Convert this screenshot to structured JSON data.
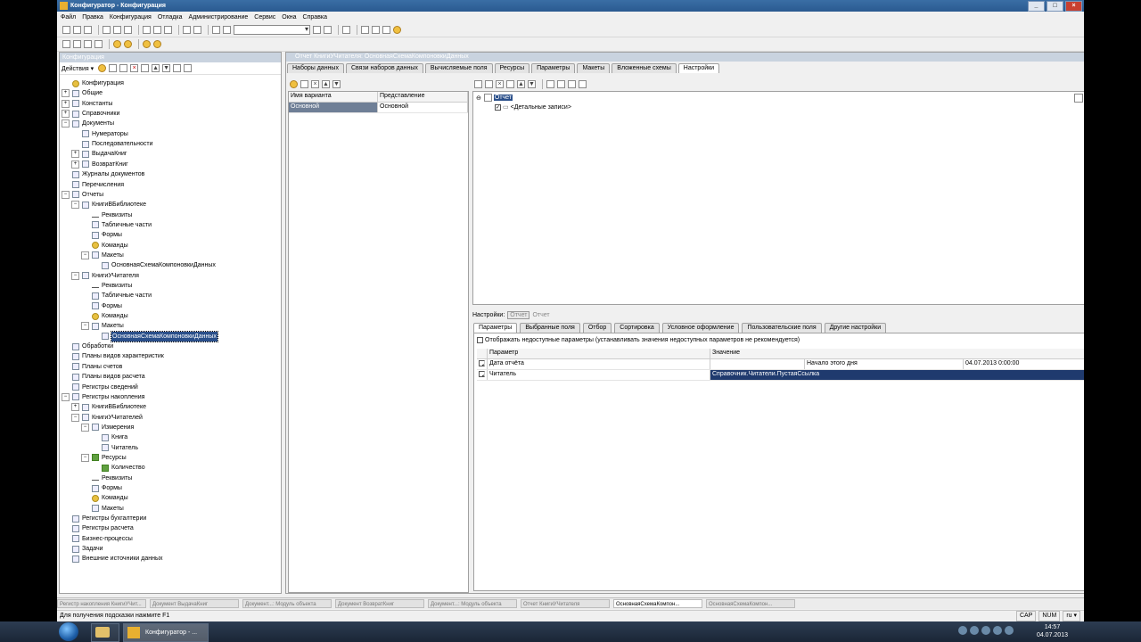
{
  "window": {
    "title": "Конфигуратор - Конфигурация",
    "buttons": [
      "_",
      "□",
      "×"
    ]
  },
  "menu": [
    "Файл",
    "Правка",
    "Конфигурация",
    "Отладка",
    "Администрирование",
    "Сервис",
    "Окна",
    "Справка"
  ],
  "config_panel": {
    "title": "Конфигурация",
    "actions_label": "Действия",
    "tree": [
      {
        "label": "Конфигурация",
        "level": 0,
        "expander": "",
        "icon": "config-icon"
      },
      {
        "label": "Общие",
        "level": 0,
        "expander": "+",
        "icon": "common-icon"
      },
      {
        "label": "Константы",
        "level": 0,
        "expander": "+",
        "icon": "constants-icon"
      },
      {
        "label": "Справочники",
        "level": 0,
        "expander": "+",
        "icon": "catalogs-icon"
      },
      {
        "label": "Документы",
        "level": 0,
        "expander": "−",
        "icon": "documents-icon"
      },
      {
        "label": "Нумераторы",
        "level": 1,
        "expander": "",
        "icon": "numerators-icon"
      },
      {
        "label": "Последовательности",
        "level": 1,
        "expander": "",
        "icon": "sequences-icon"
      },
      {
        "label": "ВыдачаКниг",
        "level": 1,
        "expander": "+",
        "icon": "document-icon"
      },
      {
        "label": "ВозвратКниг",
        "level": 1,
        "expander": "+",
        "icon": "document-icon"
      },
      {
        "label": "Журналы документов",
        "level": 0,
        "expander": "",
        "icon": "journals-icon"
      },
      {
        "label": "Перечисления",
        "level": 0,
        "expander": "",
        "icon": "enums-icon"
      },
      {
        "label": "Отчеты",
        "level": 0,
        "expander": "−",
        "icon": "reports-icon"
      },
      {
        "label": "КнигиВБиблиотеке",
        "level": 1,
        "expander": "−",
        "icon": "report-icon"
      },
      {
        "label": "Реквизиты",
        "level": 2,
        "expander": "",
        "icon": "attributes-icon"
      },
      {
        "label": "Табличные части",
        "level": 2,
        "expander": "",
        "icon": "tabular-icon"
      },
      {
        "label": "Формы",
        "level": 2,
        "expander": "",
        "icon": "forms-icon"
      },
      {
        "label": "Команды",
        "level": 2,
        "expander": "",
        "icon": "commands-icon"
      },
      {
        "label": "Макеты",
        "level": 2,
        "expander": "−",
        "icon": "templates-icon"
      },
      {
        "label": "ОсновнаяСхемаКомпоновкиДанных",
        "level": 3,
        "expander": "",
        "icon": "template-icon"
      },
      {
        "label": "КнигиУЧитателя",
        "level": 1,
        "expander": "−",
        "icon": "report-icon"
      },
      {
        "label": "Реквизиты",
        "level": 2,
        "expander": "",
        "icon": "attributes-icon"
      },
      {
        "label": "Табличные части",
        "level": 2,
        "expander": "",
        "icon": "tabular-icon"
      },
      {
        "label": "Формы",
        "level": 2,
        "expander": "",
        "icon": "forms-icon"
      },
      {
        "label": "Команды",
        "level": 2,
        "expander": "",
        "icon": "commands-icon"
      },
      {
        "label": "Макеты",
        "level": 2,
        "expander": "−",
        "icon": "templates-icon"
      },
      {
        "label": "ОсновнаяСхемаКомпоновкиДанных",
        "level": 3,
        "expander": "",
        "icon": "template-icon",
        "selected": true
      },
      {
        "label": "Обработки",
        "level": 0,
        "expander": "",
        "icon": "processing-icon"
      },
      {
        "label": "Планы видов характеристик",
        "level": 0,
        "expander": "",
        "icon": "chart-types-icon"
      },
      {
        "label": "Планы счетов",
        "level": 0,
        "expander": "",
        "icon": "accounts-icon"
      },
      {
        "label": "Планы видов расчета",
        "level": 0,
        "expander": "",
        "icon": "calc-types-icon"
      },
      {
        "label": "Регистры сведений",
        "level": 0,
        "expander": "",
        "icon": "info-registers-icon"
      },
      {
        "label": "Регистры накопления",
        "level": 0,
        "expander": "−",
        "icon": "accum-registers-icon"
      },
      {
        "label": "КнигиВБиблиотеке",
        "level": 1,
        "expander": "+",
        "icon": "register-icon"
      },
      {
        "label": "КнигиУЧитателей",
        "level": 1,
        "expander": "−",
        "icon": "register-icon"
      },
      {
        "label": "Измерения",
        "level": 2,
        "expander": "−",
        "icon": "dimensions-icon"
      },
      {
        "label": "Книга",
        "level": 3,
        "expander": "",
        "icon": "dimension-icon"
      },
      {
        "label": "Читатель",
        "level": 3,
        "expander": "",
        "icon": "dimension-icon"
      },
      {
        "label": "Ресурсы",
        "level": 2,
        "expander": "−",
        "icon": "resources-icon"
      },
      {
        "label": "Количество",
        "level": 3,
        "expander": "",
        "icon": "resource-icon"
      },
      {
        "label": "Реквизиты",
        "level": 2,
        "expander": "",
        "icon": "attributes-icon"
      },
      {
        "label": "Формы",
        "level": 2,
        "expander": "",
        "icon": "forms-icon"
      },
      {
        "label": "Команды",
        "level": 2,
        "expander": "",
        "icon": "commands-icon"
      },
      {
        "label": "Макеты",
        "level": 2,
        "expander": "",
        "icon": "templates-icon"
      },
      {
        "label": "Регистры бухгалтерии",
        "level": 0,
        "expander": "",
        "icon": "acc-registers-icon"
      },
      {
        "label": "Регистры расчета",
        "level": 0,
        "expander": "",
        "icon": "calc-registers-icon"
      },
      {
        "label": "Бизнес-процессы",
        "level": 0,
        "expander": "",
        "icon": "bp-icon"
      },
      {
        "label": "Задачи",
        "level": 0,
        "expander": "",
        "icon": "tasks-icon"
      },
      {
        "label": "Внешние источники данных",
        "level": 0,
        "expander": "",
        "icon": "ext-sources-icon"
      }
    ]
  },
  "editor": {
    "title": "Отчет КнигиУЧитателя: ОсновнаяСхемаКомпоновкиДанных",
    "tabs": [
      "Наборы данных",
      "Связи наборов данных",
      "Вычисляемые поля",
      "Ресурсы",
      "Параметры",
      "Макеты",
      "Вложенные схемы",
      "Настройки"
    ],
    "active_tab": 7,
    "variants": {
      "headers": [
        "Имя варианта",
        "Представление"
      ],
      "rows": [
        [
          "Основной",
          "Основной"
        ]
      ]
    },
    "structure": {
      "root": "Отчет",
      "child": "<Детальные записи>"
    },
    "settings_label": "Настройки:",
    "settings_btn": "Отчет",
    "settings_current": "Отчет",
    "settings_tabs": [
      "Параметры",
      "Выбранные поля",
      "Отбор",
      "Сортировка",
      "Условное оформление",
      "Пользовательские поля",
      "Другие настройки"
    ],
    "show_unavailable": "Отображать недоступные параметры (устанавливать значения недоступных параметров не рекомендуется)",
    "params": {
      "headers": [
        "Параметр",
        "Значение"
      ],
      "rows": [
        {
          "name": "Дата отчёта",
          "value": "",
          "extra1": "Начало этого дня",
          "extra2": "04.07.2013 0:00:00"
        },
        {
          "name": "Читатель",
          "value": "Справочник.Читатели.ПустаяСсылка",
          "extra1": "",
          "extra2": ""
        }
      ]
    }
  },
  "window_strip": [
    "Регистр накопления КнигиУЧит...",
    "Документ ВыдачаКниг",
    "Документ...: Модуль объекта",
    "Документ ВозвратКниг",
    "Документ...: Модуль объекта",
    "Отчет КнигиУЧитателя",
    "ОсновнаяСхемаКомпон...",
    "ОсновнаяСхемаКомпон..."
  ],
  "window_strip_active": 6,
  "status": {
    "hint": "Для получения подсказки нажмите F1",
    "indicators": [
      "CAP",
      "NUM",
      "ru ▾"
    ]
  },
  "taskbar": {
    "app_label": "Конфигуратор - ...",
    "time": "14:57",
    "date": "04.07.2013"
  }
}
